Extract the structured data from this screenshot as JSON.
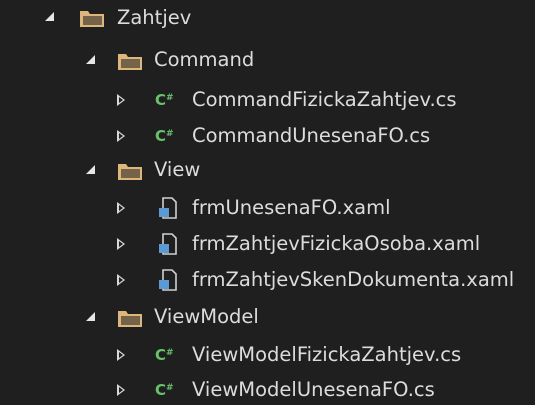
{
  "tree": {
    "root": {
      "label": "Zahtjev",
      "icon": "folder-icon",
      "expanded": true
    },
    "folders": [
      {
        "label": "Command",
        "icon": "folder-icon",
        "expanded": true,
        "files": [
          {
            "label": "CommandFizickaZahtjev.cs",
            "icon": "csharp-file-icon"
          },
          {
            "label": "CommandUnesenaFO.cs",
            "icon": "csharp-file-icon"
          }
        ]
      },
      {
        "label": "View",
        "icon": "folder-icon",
        "expanded": true,
        "files": [
          {
            "label": "frmUnesenaFO.xaml",
            "icon": "xaml-file-icon"
          },
          {
            "label": "frmZahtjevFizickaOsoba.xaml",
            "icon": "xaml-file-icon"
          },
          {
            "label": "frmZahtjevSkenDokumenta.xaml",
            "icon": "xaml-file-icon"
          }
        ]
      },
      {
        "label": "ViewModel",
        "icon": "folder-icon",
        "expanded": true,
        "files": [
          {
            "label": "ViewModelFizickaZahtjev.cs",
            "icon": "csharp-file-icon"
          },
          {
            "label": "ViewModelUnesenaFO.cs",
            "icon": "csharp-file-icon"
          }
        ]
      }
    ]
  },
  "colors": {
    "background": "#1f1f1f",
    "text": "#dcdcdc",
    "folder": "#dcb67a",
    "csharp_icon": "#68c26b",
    "xaml_icon": "#5b9bd5"
  }
}
